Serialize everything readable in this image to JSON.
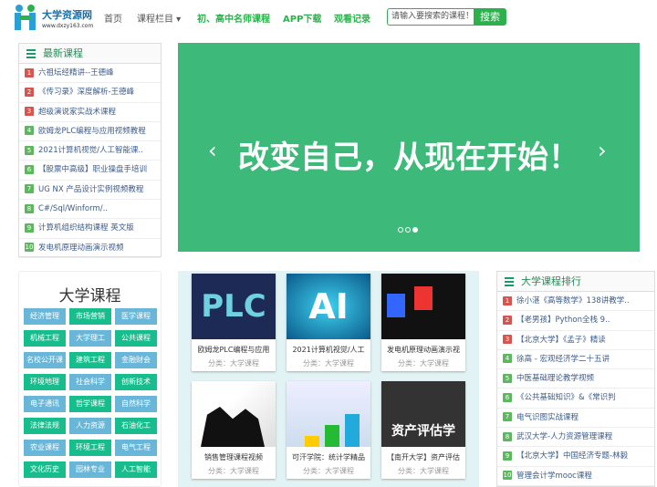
{
  "header": {
    "logo_title": "大学资源网",
    "logo_url": "www.dxzy163.com",
    "nav": [
      "首页",
      "课程栏目 ▾",
      "初、高中名师课程",
      "APP下载",
      "观看记录"
    ],
    "search_placeholder": "请输入要搜索的课程！",
    "search_button": "搜索"
  },
  "latest": {
    "title": "最新课程",
    "items": [
      "六祖坛经精讲--王德峰",
      "《传习录》深度解析-王德峰",
      "超级演说家实战术课程",
      "欧姆龙PLC编程与应用视频教程",
      "2021计算机视觉/人工智能课..",
      "【股票中高级】职业操盘手培训",
      "UG NX 产品设计实例视频教程",
      "C#/Sql/Winform/..",
      "计算机组织结构课程 英文版",
      "发电机原理动画演示视频"
    ]
  },
  "banner": {
    "text": "改变自己，从现在开始！",
    "prev": "‹",
    "next": "›",
    "slides": 3,
    "active": 3
  },
  "categories": {
    "title": "大学课程",
    "tags": [
      "经济管理",
      "市场营销",
      "医学课程",
      "机械工程",
      "大学理工",
      "公共课程",
      "名校公开课",
      "建筑工程",
      "金融财会",
      "环境地理",
      "社会科学",
      "创新技术",
      "电子通讯",
      "哲学课程",
      "自然科学",
      "法律法规",
      "人力资源",
      "石油化工",
      "农业课程",
      "环境工程",
      "电气工程",
      "文化历史",
      "园林专业",
      "人工智能"
    ]
  },
  "cards": [
    {
      "title": "欧姆龙PLC编程与应用",
      "category": "分类：大学课程",
      "img_text": "PLC"
    },
    {
      "title": "2021计算机视觉/人工",
      "category": "分类：大学课程",
      "img_text": "AI"
    },
    {
      "title": "发电机原理动画演示视",
      "category": "分类：大学课程",
      "img_text": ""
    },
    {
      "title": "销售管理课程视频",
      "category": "分类：大学课程",
      "img_text": ""
    },
    {
      "title": "可汗学院：统计学精品",
      "category": "分类：大学课程",
      "img_text": ""
    },
    {
      "title": "【南开大学】资产评估",
      "category": "分类：大学课程",
      "img_text": "资产评估学"
    }
  ],
  "ranking": {
    "title": "大学课程排行",
    "items": [
      "徐小湛《高等数学》138讲教学..",
      "【老男孩】Python全栈 9..",
      "【北京大学】《孟子》精读",
      "徐高 - 宏观经济学二十五讲",
      "中医基础理论教学视频",
      "《公共基础知识》&《常识判",
      "电气识图实战课程",
      "武汉大学-人力资源管理课程",
      "【北京大学】中国经济专题-林毅",
      "管理会计学mooc课程"
    ]
  }
}
